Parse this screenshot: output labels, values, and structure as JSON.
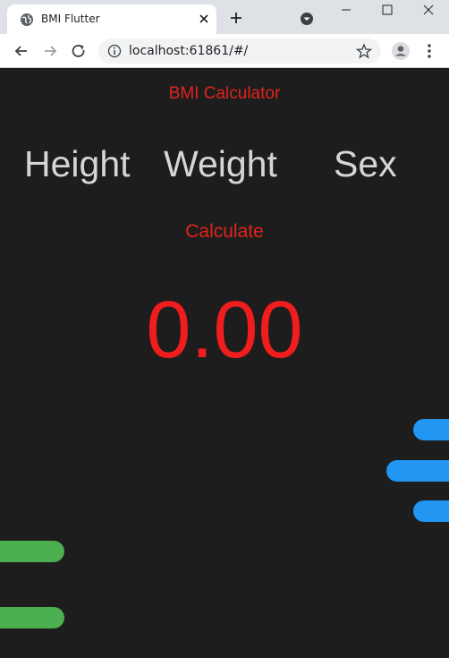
{
  "browser": {
    "tab_title": "BMI Flutter",
    "url": "localhost:61861/#/"
  },
  "app": {
    "title": "BMI Calculator",
    "labels": {
      "height": "Height",
      "weight": "Weight",
      "sex": "Sex"
    },
    "calculate_label": "Calculate",
    "result": "0.00"
  },
  "icons": {
    "tab_favicon": "globe-icon",
    "tab_close": "close-icon",
    "new_tab": "plus-icon",
    "tab_search": "chevron-down-circle-icon",
    "back": "arrow-left-icon",
    "forward": "arrow-right-icon",
    "reload": "reload-icon",
    "site_info": "info-icon",
    "bookmark": "star-icon",
    "profile": "profile-icon",
    "menu": "more-vert-icon"
  },
  "colors": {
    "background": "#1d1d1d",
    "accent_red": "#e0241b",
    "label_gray": "#d6d6d6",
    "blue_bar": "#2196f3",
    "green_bar": "#4caf50"
  }
}
